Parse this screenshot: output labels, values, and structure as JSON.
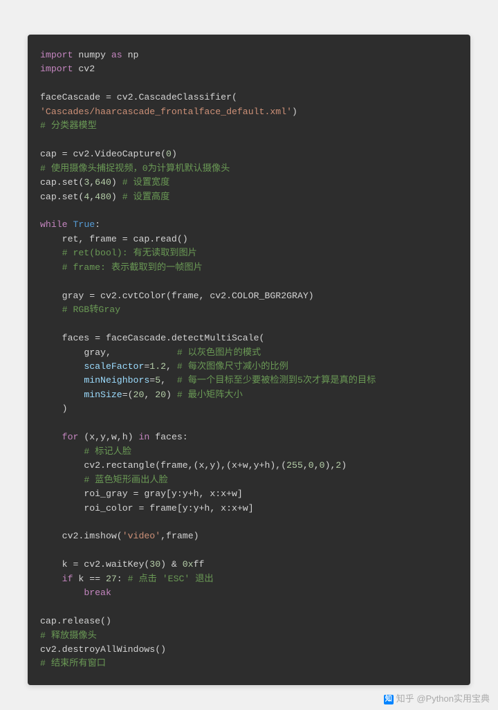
{
  "code": {
    "l1": {
      "kw1": "import",
      "mod1": " numpy ",
      "kw2": "as",
      "alias": " np"
    },
    "l2": {
      "kw1": "import",
      "mod1": " cv2"
    },
    "l3": "",
    "l4": {
      "var": "faceCascade ",
      "op": "=",
      "rest": " cv2.CascadeClassifier("
    },
    "l5": {
      "str": "'Cascades/haarcascade_frontalface_default.xml'",
      "rest": ")"
    },
    "l6": {
      "comment": "# 分类器模型"
    },
    "l7": "",
    "l8": {
      "var": "cap ",
      "op": "=",
      "rest": " cv2.VideoCapture(",
      "num": "0",
      "close": ")"
    },
    "l9": {
      "comment": "# 使用摄像头捕捉视频，0为计算机默认摄像头"
    },
    "l10": {
      "call": "cap.set(",
      "n1": "3",
      "sep": ",",
      "n2": "640",
      "close": ") ",
      "comment": "# 设置宽度"
    },
    "l11": {
      "call": "cap.set(",
      "n1": "4",
      "sep": ",",
      "n2": "480",
      "close": ") ",
      "comment": "# 设置高度"
    },
    "l12": "",
    "l13": {
      "kw": "while",
      "rest": " ",
      "val": "True",
      "colon": ":"
    },
    "l14": {
      "indent": "    ",
      "rest": "ret, frame = cap.read()"
    },
    "l15": {
      "indent": "    ",
      "comment": "# ret(bool): 有无读取到图片"
    },
    "l16": {
      "indent": "    ",
      "comment": "# frame: 表示截取到的一帧图片"
    },
    "l17": "",
    "l18": {
      "indent": "    ",
      "rest": "gray = cv2.cvtColor(frame, cv2.COLOR_BGR2GRAY)"
    },
    "l19": {
      "indent": "    ",
      "comment": "# RGB转Gray"
    },
    "l20": "",
    "l21": {
      "indent": "    ",
      "rest": "faces = faceCascade.detectMultiScale("
    },
    "l22": {
      "indent": "        ",
      "rest": "gray,            ",
      "comment": "# 以灰色图片的模式"
    },
    "l23": {
      "indent": "        ",
      "param": "scaleFactor",
      "eq": "=",
      "num": "1.2",
      "sep": ", ",
      "comment": "# 每次图像尺寸减小的比例"
    },
    "l24": {
      "indent": "        ",
      "param": "minNeighbors",
      "eq": "=",
      "num": "5",
      "sep": ",  ",
      "comment": "# 每一个目标至少要被检测到5次才算是真的目标"
    },
    "l25": {
      "indent": "        ",
      "param": "minSize",
      "eq": "=(",
      "n1": "20",
      "sep": ", ",
      "n2": "20",
      "close": ") ",
      "comment": "# 最小矩阵大小"
    },
    "l26": {
      "indent": "    ",
      "rest": ")"
    },
    "l27": "",
    "l28": {
      "indent": "    ",
      "kw": "for",
      "rest": " (x,y,w,h) ",
      "kw2": "in",
      "rest2": " faces:"
    },
    "l29": {
      "indent": "        ",
      "comment": "# 标记人脸"
    },
    "l30": {
      "indent": "        ",
      "rest": "cv2.rectangle(frame,(x,y),(x+w,y+h),(",
      "n1": "255",
      "s1": ",",
      "n2": "0",
      "s2": ",",
      "n3": "0",
      "close": "),",
      "n4": "2",
      "end": ")"
    },
    "l31": {
      "indent": "        ",
      "comment": "# 蓝色矩形画出人脸"
    },
    "l32": {
      "indent": "        ",
      "rest": "roi_gray = gray[y:y+h, x:x+w]"
    },
    "l33": {
      "indent": "        ",
      "rest": "roi_color = frame[y:y+h, x:x+w]"
    },
    "l34": "",
    "l35": {
      "indent": "    ",
      "rest": "cv2.imshow(",
      "str": "'video'",
      "rest2": ",frame)"
    },
    "l36": "",
    "l37": {
      "indent": "    ",
      "rest": "k = cv2.waitKey(",
      "num": "30",
      "rest2": ") & ",
      "hex": "0x",
      "rest3": "ff"
    },
    "l38": {
      "indent": "    ",
      "kw": "if",
      "rest": " k == ",
      "num": "27",
      "colon": ": ",
      "comment": "# 点击 'ESC' 退出"
    },
    "l39": {
      "indent": "        ",
      "kw": "break"
    },
    "l40": "",
    "l41": {
      "rest": "cap.release()"
    },
    "l42": {
      "comment": "# 释放摄像头"
    },
    "l43": {
      "rest": "cv2.destroyAllWindows()"
    },
    "l44": {
      "comment": "# 结束所有窗口"
    }
  },
  "watermark": {
    "source": "知乎",
    "author": "@Python实用宝典"
  }
}
